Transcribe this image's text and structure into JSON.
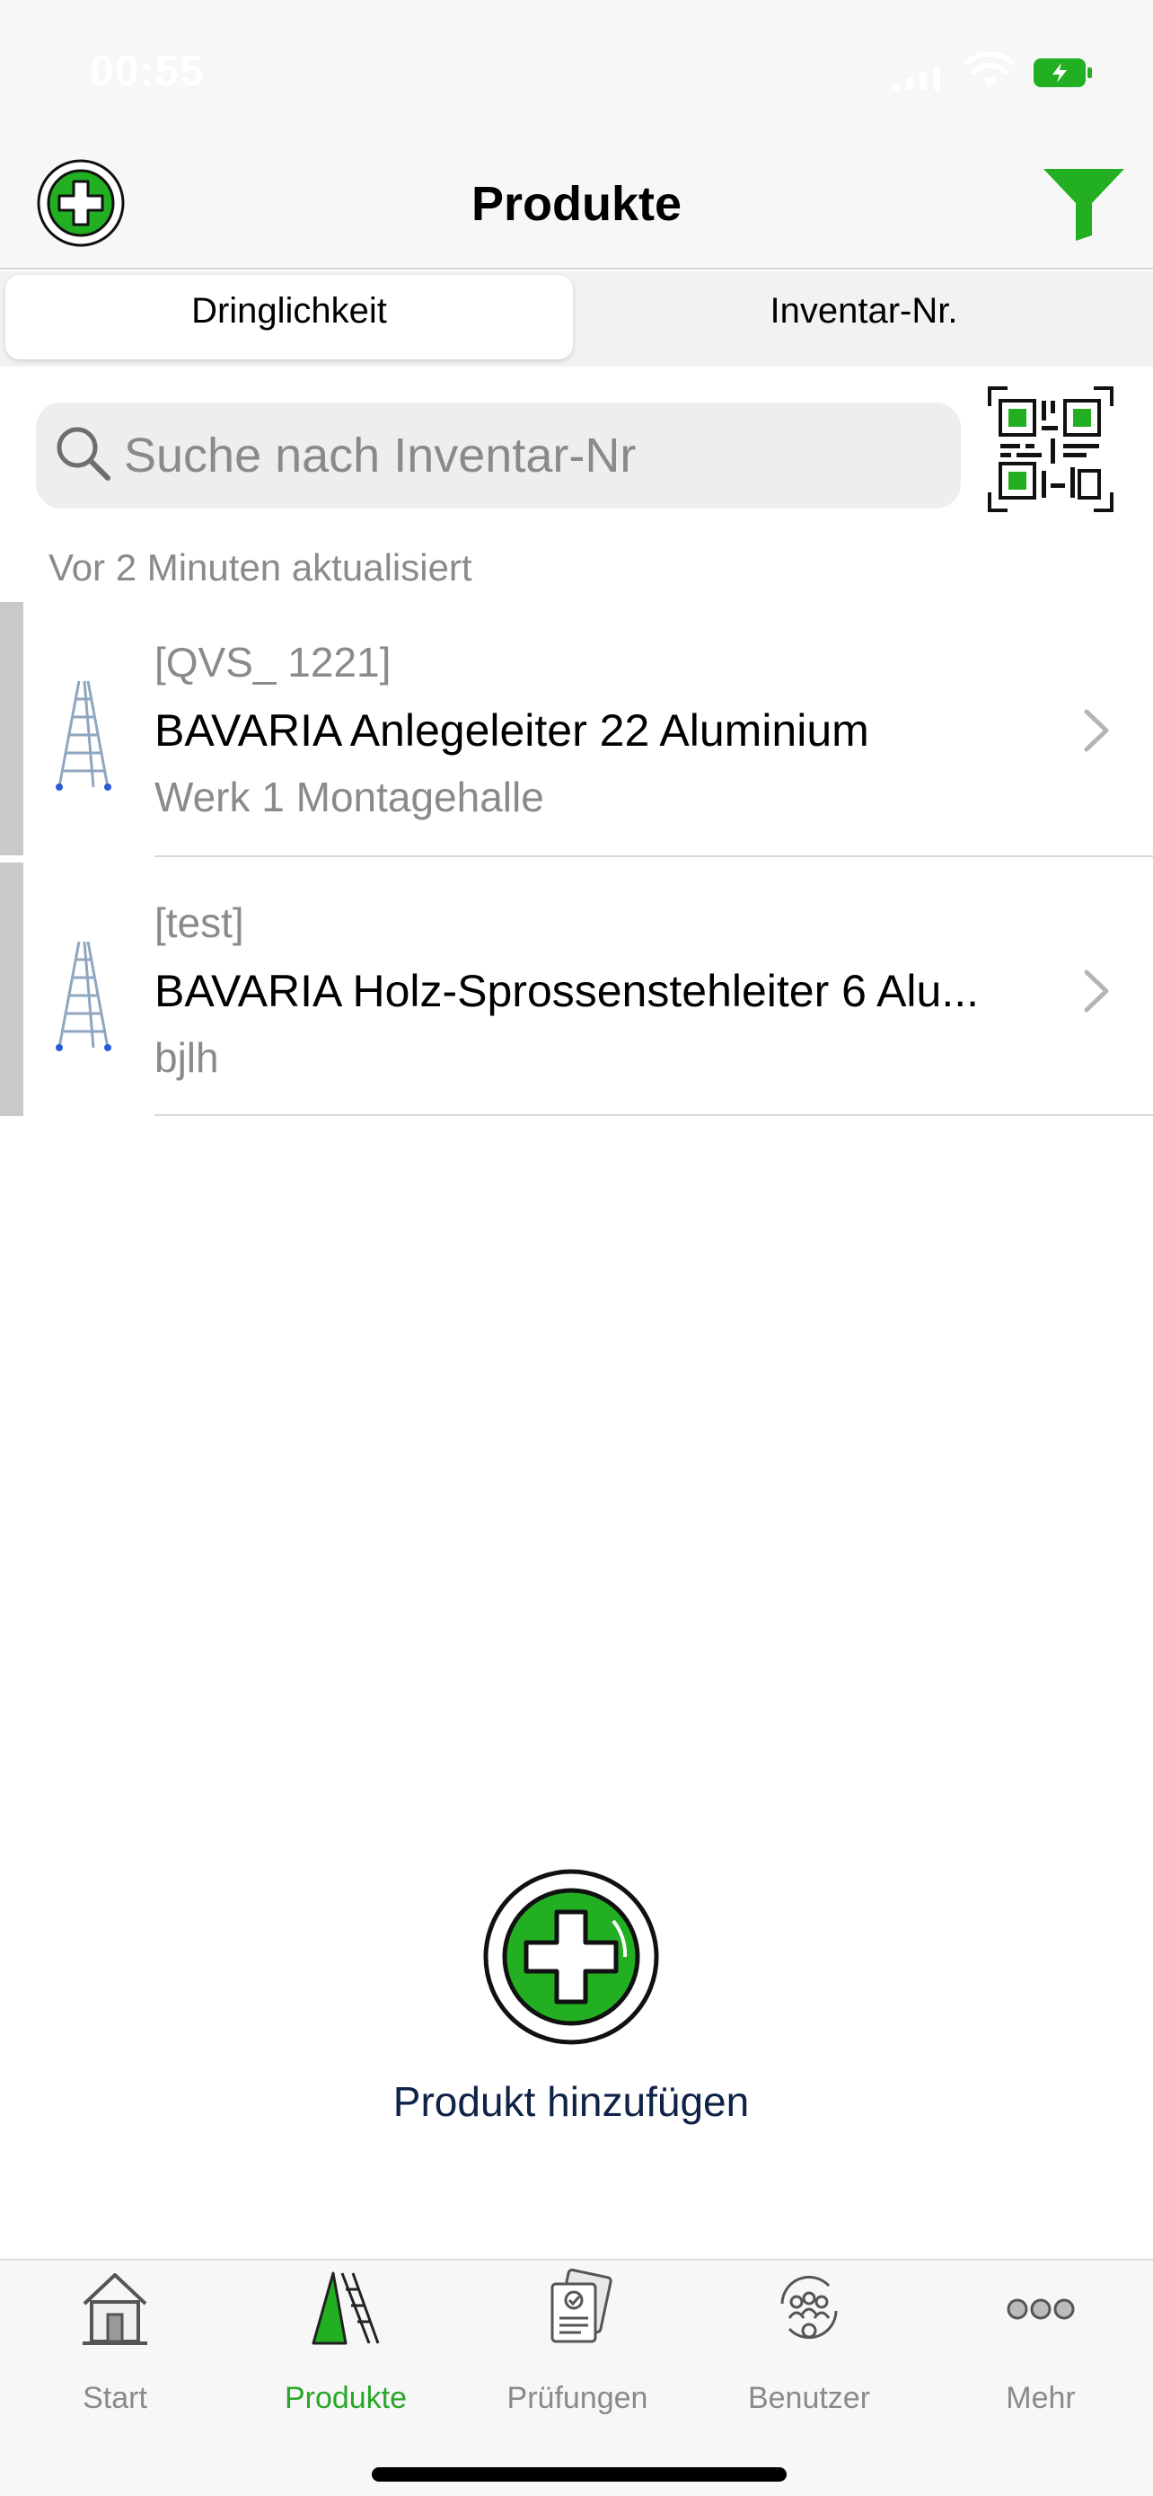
{
  "status_bar": {
    "time": "00:55"
  },
  "nav": {
    "title": "Produkte",
    "add_icon": "plus-circle-icon",
    "filter_icon": "filter-funnel-icon"
  },
  "segments": {
    "left": "Dringlichkeit",
    "right": "Inventar-Nr.",
    "selected": "Dringlichkeit"
  },
  "search": {
    "placeholder": "Suche nach Inventar-Nr",
    "value": ""
  },
  "updated_text": "Vor 2 Minuten aktualisiert",
  "products": [
    {
      "id": "[QVS_ 1221]",
      "name": "BAVARIA Anlegeleiter 22 Aluminium",
      "location": "Werk 1 Montagehalle"
    },
    {
      "id": "[test]",
      "name": "BAVARIA Holz-Sprossenstehleiter 6 Alu...",
      "location": "bjlh"
    }
  ],
  "empty_action": {
    "label": "Produkt hinzufügen"
  },
  "tabs": [
    {
      "label": "Start",
      "icon": "house-icon"
    },
    {
      "label": "Produkte",
      "icon": "ladder-icon",
      "active": true
    },
    {
      "label": "Prüfungen",
      "icon": "inspection-clipboard-icon"
    },
    {
      "label": "Benutzer",
      "icon": "users-icon"
    },
    {
      "label": "Mehr",
      "icon": "more-dots-icon"
    }
  ],
  "colors": {
    "accent_green": "#22b022",
    "tab_active": "#27a827",
    "label_blue": "#0e2347"
  }
}
